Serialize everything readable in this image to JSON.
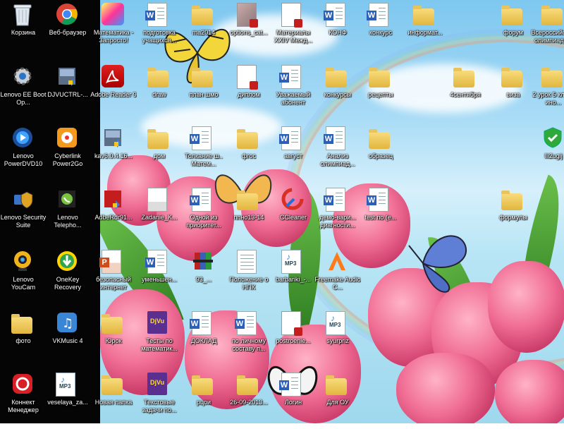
{
  "desktop": {
    "icons": [
      {
        "label": "Корзина",
        "icon": "recycle-bin-icon",
        "type": "bin"
      },
      {
        "label": "Веб-браузер",
        "icon": "chrome-icon",
        "type": "chrome"
      },
      {
        "label": "Математика - Запросто!",
        "icon": "math-app-icon",
        "type": "mathapp"
      },
      {
        "label": "подготовка учащихся...",
        "icon": "word-document-icon",
        "type": "doc"
      },
      {
        "label": "ma2014",
        "icon": "folder-icon",
        "type": "folder"
      },
      {
        "label": "options_cat...",
        "icon": "pdf-document-icon",
        "type": "pdfphoto"
      },
      {
        "label": "Материалы XXIV Межд...",
        "icon": "pdf-document-icon",
        "type": "pdf"
      },
      {
        "label": "КОНФ",
        "icon": "word-document-icon",
        "type": "doc"
      },
      {
        "label": "конкурс",
        "icon": "word-document-icon",
        "type": "doc"
      },
      {
        "label": "информат...",
        "icon": "folder-icon",
        "type": "folder"
      },
      {
        "label": "форум",
        "icon": "folder-icon",
        "type": "folder"
      },
      {
        "label": "Всероссийская олимпиада...",
        "icon": "folder-icon",
        "type": "folder"
      },
      {
        "label": "Lenovo EE Boot Op...",
        "icon": "gear-settings-icon",
        "type": "lenovoee"
      },
      {
        "label": "DJVUCTRL-...",
        "icon": "installer-icon",
        "type": "installer"
      },
      {
        "label": "Adobe Reader 9",
        "icon": "adobe-reader-icon",
        "type": "adobe"
      },
      {
        "label": "draw",
        "icon": "folder-icon",
        "type": "folder"
      },
      {
        "label": "план шмо",
        "icon": "folder-icon",
        "type": "folder"
      },
      {
        "label": "диплом",
        "icon": "pdf-document-icon",
        "type": "pdf"
      },
      {
        "label": "Уважаемый абонент",
        "icon": "word-document-icon",
        "type": "doc"
      },
      {
        "label": "конкурсы",
        "icon": "folder-icon",
        "type": "folder"
      },
      {
        "label": "рецепты",
        "icon": "folder-icon",
        "type": "folder"
      },
      {
        "label": "4сентября",
        "icon": "folder-icon",
        "type": "folder"
      },
      {
        "label": "виза",
        "icon": "folder-icon",
        "type": "folder"
      },
      {
        "label": "2 урок 5 класс ино...",
        "icon": "folder-icon",
        "type": "folder"
      },
      {
        "label": "Lenovo PowerDVD10",
        "icon": "powerdvd-icon",
        "type": "dvd"
      },
      {
        "label": "Cyberlink Power2Go",
        "icon": "power2go-icon",
        "type": "power2go"
      },
      {
        "label": "kav6.0.4.16...",
        "icon": "installer-icon",
        "type": "installer"
      },
      {
        "label": "дом",
        "icon": "folder-icon",
        "type": "folder"
      },
      {
        "label": "Толкание ш.. Матем...",
        "icon": "word-document-icon",
        "type": "doc"
      },
      {
        "label": "фгос",
        "icon": "folder-icon",
        "type": "folder"
      },
      {
        "label": "август",
        "icon": "word-document-icon",
        "type": "doc"
      },
      {
        "label": "Анализ олимпиад...",
        "icon": "word-document-icon",
        "type": "doc"
      },
      {
        "label": "образец",
        "icon": "folder-icon",
        "type": "folder"
      },
      {
        "label": "Ili2ugij",
        "icon": "green-shield-icon",
        "type": "greenshield"
      },
      {
        "label": "Lenovo Security Suite",
        "icon": "security-suite-icon",
        "type": "secsuite"
      },
      {
        "label": "Lenovo Telepho...",
        "icon": "telephony-icon",
        "type": "phone"
      },
      {
        "label": "AdbeRdr91...",
        "icon": "installer-icon",
        "type": "adbeinst"
      },
      {
        "label": "Zadanie_K...",
        "icon": "document-image-icon",
        "type": "imgdoc"
      },
      {
        "label": "Одной из приоритет...",
        "icon": "word-document-icon",
        "type": "doc"
      },
      {
        "label": "ппно13-14",
        "icon": "folder-icon",
        "type": "folder"
      },
      {
        "label": "CCleaner",
        "icon": "ccleaner-icon",
        "type": "ccleaner"
      },
      {
        "label": "демо-вари... диагности...",
        "icon": "word-document-icon",
        "type": "doc"
      },
      {
        "label": "test по (е...",
        "icon": "word-document-icon",
        "type": "doc"
      },
      {
        "label": "формулы",
        "icon": "folder-icon",
        "type": "folder"
      },
      {
        "label": "Lenovo YouCam",
        "icon": "webcam-icon",
        "type": "youcam"
      },
      {
        "label": "OneKey Recovery",
        "icon": "onekey-recovery-icon",
        "type": "onekey"
      },
      {
        "label": "безопасный интернет",
        "icon": "presentation-icon",
        "type": "ppt"
      },
      {
        "label": "уменьшен...",
        "icon": "word-document-icon",
        "type": "doc"
      },
      {
        "label": "93_...",
        "icon": "archive-icon",
        "type": "rar"
      },
      {
        "label": "Положение о НПК",
        "icon": "document-icon",
        "type": "plaindoc"
      },
      {
        "label": "barbariki_-...",
        "icon": "mp3-file-icon",
        "type": "mp3"
      },
      {
        "label": "Freemake Audio C...",
        "icon": "freemake-icon",
        "type": "freemake"
      },
      {
        "label": "фото",
        "icon": "folder-icon",
        "type": "folder"
      },
      {
        "label": "VKMusic 4",
        "icon": "vkmusic-icon",
        "type": "vkmusic"
      },
      {
        "label": "Юрок",
        "icon": "folder-icon",
        "type": "folder"
      },
      {
        "label": "Тесты по математик...",
        "icon": "djvu-file-icon",
        "type": "djvu"
      },
      {
        "label": "ДОКЛАД",
        "icon": "word-document-icon",
        "type": "doc"
      },
      {
        "label": "по личному составу п...",
        "icon": "word-document-icon",
        "type": "doc"
      },
      {
        "label": "postroenie...",
        "icon": "pdf-document-icon",
        "type": "pdf"
      },
      {
        "label": "syurpriz",
        "icon": "mp3-file-icon",
        "type": "mp3"
      },
      {
        "label": "Коннект Менеджер",
        "icon": "connect-manager-icon",
        "type": "connect"
      },
      {
        "label": "veselaya_za...",
        "icon": "mp3-file-icon",
        "type": "mp3"
      },
      {
        "label": "Новая папка",
        "icon": "folder-icon",
        "type": "folder"
      },
      {
        "label": "Текстовые задачи по...",
        "icon": "djvu-file-icon",
        "type": "djvu"
      },
      {
        "label": "рцои",
        "icon": "folder-icon",
        "type": "folder"
      },
      {
        "label": "26-09-2013...",
        "icon": "folder-icon",
        "type": "folder"
      },
      {
        "label": "Логин",
        "icon": "word-document-icon",
        "type": "doc"
      },
      {
        "label": "Для ОУ",
        "icon": "folder-icon",
        "type": "folder"
      }
    ]
  }
}
